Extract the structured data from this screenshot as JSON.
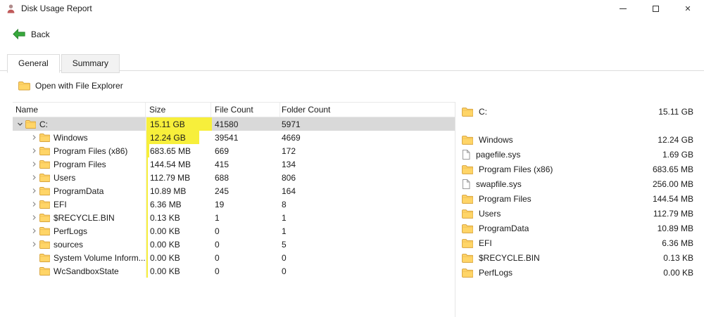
{
  "window": {
    "title": "Disk Usage Report",
    "controls": {
      "minimize": "minimize",
      "maximize": "maximize",
      "close": "✕"
    }
  },
  "toolbar": {
    "back_label": "Back"
  },
  "tabs": [
    {
      "label": "General",
      "active": true
    },
    {
      "label": "Summary",
      "active": false
    }
  ],
  "actions": {
    "open_explorer_label": "Open with File Explorer"
  },
  "colors": {
    "size_highlight": "#f7ef3b",
    "selected_row": "#d9d9d9",
    "folder_icon": "#ffd567"
  },
  "table": {
    "columns": [
      "Name",
      "Size",
      "File Count",
      "Folder Count"
    ],
    "rows": [
      {
        "name": "C:",
        "size": "15.11 GB",
        "files": "41580",
        "folders": "5971",
        "depth": 0,
        "chevron": "down",
        "selected": true,
        "highlight_pct": 100
      },
      {
        "name": "Windows",
        "size": "12.24 GB",
        "files": "39541",
        "folders": "4669",
        "depth": 1,
        "chevron": "right",
        "selected": false,
        "highlight_pct": 81
      },
      {
        "name": "Program Files (x86)",
        "size": "683.65 MB",
        "files": "669",
        "folders": "172",
        "depth": 1,
        "chevron": "right",
        "selected": false,
        "highlight_pct": 4.4
      },
      {
        "name": "Program Files",
        "size": "144.54 MB",
        "files": "415",
        "folders": "134",
        "depth": 1,
        "chevron": "right",
        "selected": false,
        "highlight_pct": 1
      },
      {
        "name": "Users",
        "size": "112.79 MB",
        "files": "688",
        "folders": "806",
        "depth": 1,
        "chevron": "right",
        "selected": false,
        "highlight_pct": 0.8
      },
      {
        "name": "ProgramData",
        "size": "10.89 MB",
        "files": "245",
        "folders": "164",
        "depth": 1,
        "chevron": "right",
        "selected": false,
        "highlight_pct": 0.1
      },
      {
        "name": "EFI",
        "size": "6.36 MB",
        "files": "19",
        "folders": "8",
        "depth": 1,
        "chevron": "right",
        "selected": false,
        "highlight_pct": 0.1
      },
      {
        "name": "$RECYCLE.BIN",
        "size": "0.13 KB",
        "files": "1",
        "folders": "1",
        "depth": 1,
        "chevron": "right",
        "selected": false,
        "highlight_pct": 0
      },
      {
        "name": "PerfLogs",
        "size": "0.00 KB",
        "files": "0",
        "folders": "1",
        "depth": 1,
        "chevron": "right",
        "selected": false,
        "highlight_pct": 0
      },
      {
        "name": "sources",
        "size": "0.00 KB",
        "files": "0",
        "folders": "5",
        "depth": 1,
        "chevron": "right",
        "selected": false,
        "highlight_pct": 0
      },
      {
        "name": "System Volume Inform...",
        "size": "0.00 KB",
        "files": "0",
        "folders": "0",
        "depth": 1,
        "chevron": "none",
        "selected": false,
        "highlight_pct": 0
      },
      {
        "name": "WcSandboxState",
        "size": "0.00 KB",
        "files": "0",
        "folders": "0",
        "depth": 1,
        "chevron": "none",
        "selected": false,
        "highlight_pct": 0
      }
    ]
  },
  "summary_panel": {
    "items": [
      {
        "name": "C:",
        "size": "15.11 GB",
        "icon": "folder",
        "gap_after": true
      },
      {
        "name": "Windows",
        "size": "12.24 GB",
        "icon": "folder",
        "gap_after": false
      },
      {
        "name": "pagefile.sys",
        "size": "1.69 GB",
        "icon": "file",
        "gap_after": false
      },
      {
        "name": "Program Files (x86)",
        "size": "683.65 MB",
        "icon": "folder",
        "gap_after": false
      },
      {
        "name": "swapfile.sys",
        "size": "256.00 MB",
        "icon": "file",
        "gap_after": false
      },
      {
        "name": "Program Files",
        "size": "144.54 MB",
        "icon": "folder",
        "gap_after": false
      },
      {
        "name": "Users",
        "size": "112.79 MB",
        "icon": "folder",
        "gap_after": false
      },
      {
        "name": "ProgramData",
        "size": "10.89 MB",
        "icon": "folder",
        "gap_after": false
      },
      {
        "name": "EFI",
        "size": "6.36 MB",
        "icon": "folder",
        "gap_after": false
      },
      {
        "name": "$RECYCLE.BIN",
        "size": "0.13 KB",
        "icon": "folder",
        "gap_after": false
      },
      {
        "name": "PerfLogs",
        "size": "0.00 KB",
        "icon": "folder",
        "gap_after": false
      }
    ]
  }
}
